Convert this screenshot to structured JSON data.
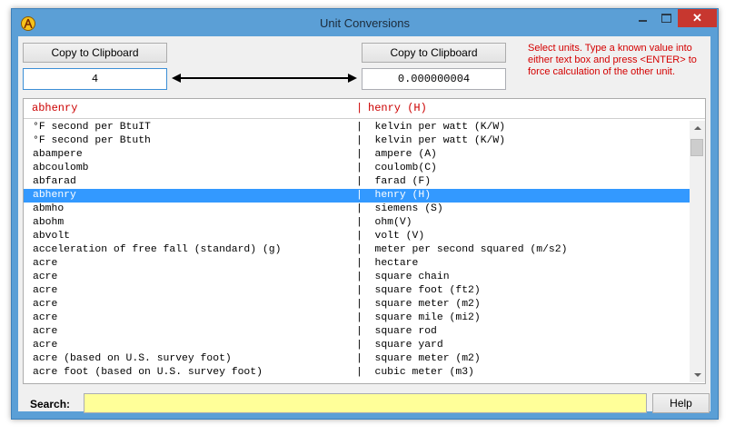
{
  "window": {
    "title": "Unit  Conversions"
  },
  "left": {
    "copy_label": "Copy  to  Clipboard",
    "value": "4"
  },
  "right": {
    "copy_label": "Copy  to  Clipboard",
    "value": "0.000000004"
  },
  "hint": "Select units.  Type a known value into either text box and press  <ENTER>  to force calculation of the other unit.",
  "header": {
    "from_unit": "abhenry",
    "separator": "|",
    "to_unit": "henry (H)"
  },
  "rows": [
    {
      "from": "°F second per BtuIT",
      "to": "|  kelvin per watt (K/W)"
    },
    {
      "from": "°F second per Btuth",
      "to": "|  kelvin per watt (K/W)"
    },
    {
      "from": "abampere",
      "to": "|  ampere (A)"
    },
    {
      "from": "abcoulomb",
      "to": "|  coulomb(C)"
    },
    {
      "from": "abfarad",
      "to": "|  farad (F)"
    },
    {
      "from": "abhenry",
      "to": "|  henry (H)",
      "selected": true
    },
    {
      "from": "abmho",
      "to": "|  siemens (S)"
    },
    {
      "from": "abohm",
      "to": "|  ohm(V)"
    },
    {
      "from": "abvolt",
      "to": "|  volt (V)"
    },
    {
      "from": "acceleration of free fall (standard) (g)",
      "to": "|  meter per second squared (m/s2)"
    },
    {
      "from": "acre",
      "to": "|  hectare"
    },
    {
      "from": "acre",
      "to": "|  square chain"
    },
    {
      "from": "acre",
      "to": "|  square foot (ft2)"
    },
    {
      "from": "acre",
      "to": "|  square meter (m2)"
    },
    {
      "from": "acre",
      "to": "|  square mile (mi2)"
    },
    {
      "from": "acre",
      "to": "|  square rod"
    },
    {
      "from": "acre",
      "to": "|  square yard"
    },
    {
      "from": "acre (based on U.S. survey foot)",
      "to": "|  square meter (m2)"
    },
    {
      "from": "acre foot (based on U.S. survey foot)",
      "to": "|  cubic meter (m3)"
    }
  ],
  "search": {
    "label": "Search:",
    "value": ""
  },
  "help_label": "Help",
  "icons": {
    "app": "app-logo-icon",
    "arrow": "double-arrow-icon"
  },
  "colors": {
    "selection": "#3399ff",
    "hint_text": "#d40000",
    "search_bg": "#ffff99",
    "header_text": "#cc0000"
  }
}
